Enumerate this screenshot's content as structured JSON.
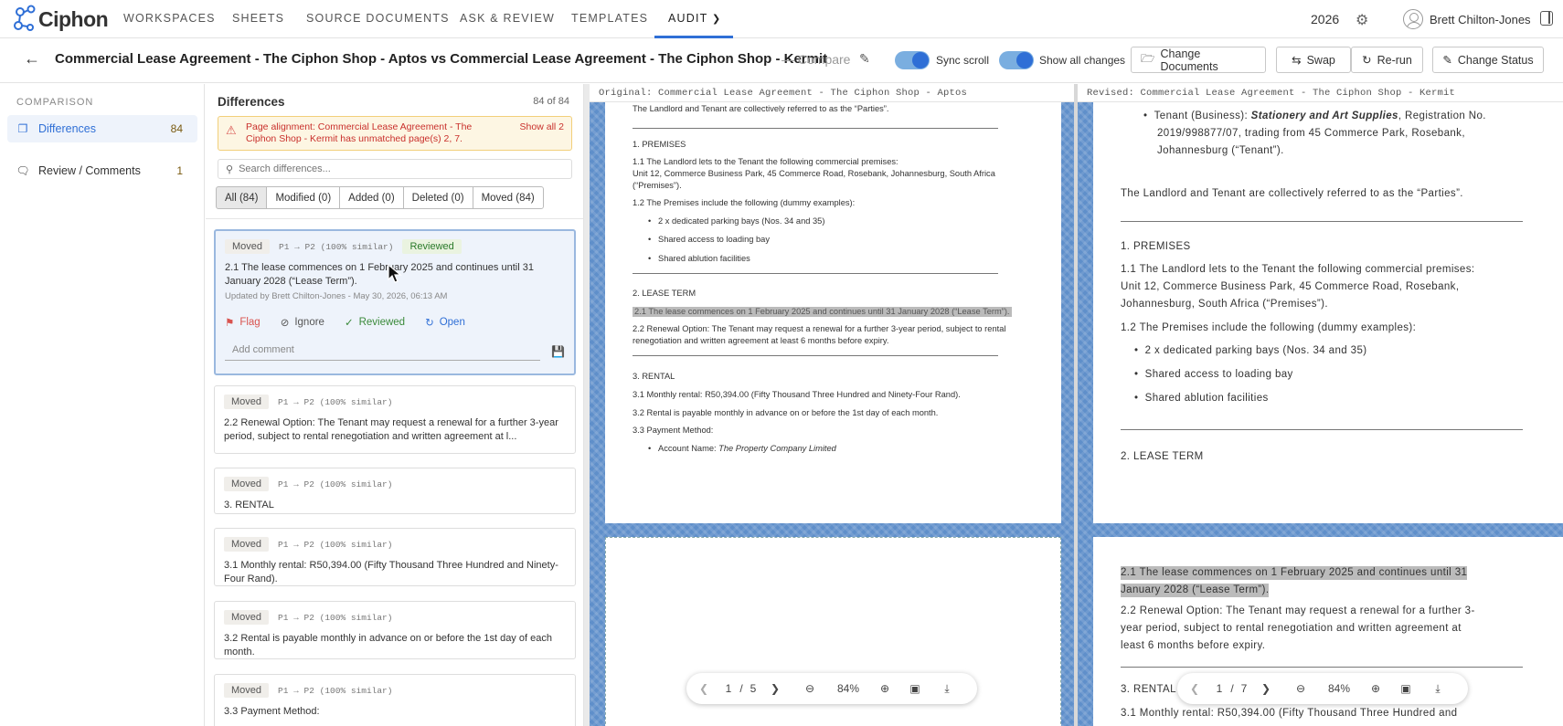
{
  "app": {
    "name": "Ciphon"
  },
  "nav": {
    "items": [
      "WORKSPACES",
      "SHEETS",
      "SOURCE DOCUMENTS",
      "ASK & REVIEW",
      "TEMPLATES",
      "AUDIT"
    ],
    "year": "2026",
    "user": "Brett Chilton-Jones"
  },
  "header": {
    "title": "Commercial Lease Agreement - The Ciphon Shop - Aptos vs Commercial Lease Agreement - The Ciphon Shop - Kermit",
    "compare": "— Compare",
    "sync_scroll": "Sync scroll",
    "show_all_changes": "Show all changes",
    "btn_change_documents": "Change Documents",
    "btn_swap": "Swap",
    "btn_rerun": "Re-run",
    "btn_change_status": "Change Status"
  },
  "sidebar": {
    "section": "COMPARISON",
    "items": [
      {
        "label": "Differences",
        "count": "84"
      },
      {
        "label": "Review / Comments",
        "count": "1"
      }
    ]
  },
  "differences": {
    "title": "Differences",
    "count": "84 of 84",
    "alert_text": "Page alignment: Commercial Lease Agreement - The Ciphon Shop - Kermit has unmatched page(s) 2, 7.",
    "alert_action": "Show all 2",
    "search_placeholder": "Search differences...",
    "filters": [
      "All (84)",
      "Modified (0)",
      "Added (0)",
      "Deleted (0)",
      "Moved (84)"
    ],
    "cards": [
      {
        "tag": "Moved",
        "meta": "P1 → P2 (100% similar)",
        "status": "Reviewed",
        "text": "2.1 The lease commences on 1 February 2025 and continues until 31 January 2028 (“Lease Term”).",
        "updated": "Updated by Brett Chilton-Jones - May 30, 2026, 06:13 AM"
      },
      {
        "tag": "Moved",
        "meta": "P1 → P2 (100% similar)",
        "text": "2.2 Renewal Option: The Tenant may request a renewal for a further 3-year period, subject to rental renegotiation and written agreement at l..."
      },
      {
        "tag": "Moved",
        "meta": "P1 → P2 (100% similar)",
        "text": "3. RENTAL"
      },
      {
        "tag": "Moved",
        "meta": "P1 → P2 (100% similar)",
        "text": "3.1 Monthly rental: R50,394.00 (Fifty Thousand Three Hundred and Ninety-Four Rand)."
      },
      {
        "tag": "Moved",
        "meta": "P1 → P2 (100% similar)",
        "text": "3.2 Rental is payable monthly in advance on or before the 1st day of each month."
      },
      {
        "tag": "Moved",
        "meta": "P1 → P2 (100% similar)",
        "text": "3.3 Payment Method:"
      }
    ],
    "actions": {
      "flag": "Flag",
      "ignore": "Ignore",
      "reviewed": "Reviewed",
      "open": "Open"
    },
    "comment_placeholder": "Add comment"
  },
  "original": {
    "header": "Original: Commercial Lease Agreement - The Ciphon Shop - Aptos",
    "lines": {
      "parties": "The Landlord and Tenant are collectively referred to as the “Parties”.",
      "premises": "1. PREMISES",
      "p11": "1.1 The Landlord lets to the Tenant the following commercial premises:",
      "p11b": "Unit 12, Commerce Business Park, 45 Commerce Road, Rosebank, Johannesburg, South Africa",
      "p11c": "(“Premises”).",
      "p12": "1.2 The Premises include the following (dummy examples):",
      "b1": "2 x dedicated parking bays (Nos. 34 and 35)",
      "b2": "Shared access to loading bay",
      "b3": "Shared ablution facilities",
      "lease": "2. LEASE TERM",
      "l21": "2.1 The lease commences on 1 February 2025 and continues until 31 January 2028 (“Lease Term”).",
      "l22": "2.2 Renewal Option: The Tenant may request a renewal for a further 3-year period, subject to rental",
      "l22b": "renegotiation and written agreement at least 6 months before expiry.",
      "rental": "3. RENTAL",
      "r31": "3.1 Monthly rental: R50,394.00 (Fifty Thousand Three Hundred and Ninety-Four Rand).",
      "r32": "3.2 Rental is payable monthly in advance on or before the 1st day of each month.",
      "r33": "3.3 Payment Method:",
      "acct_label": "Account Name: ",
      "acct_value": "The Property Company Limited"
    },
    "pager": {
      "page": "1",
      "sep": "/",
      "total": "5",
      "zoom": "84%"
    }
  },
  "revised": {
    "header": "Revised: Commercial Lease Agreement - The Ciphon Shop - Kermit",
    "lines": {
      "tenant_pre": "Tenant (Business): ",
      "tenant_name": "Stationery and Art Supplies",
      "tenant_post": ", Registration No.",
      "tenant2": "2019/998877/07, trading from 45 Commerce Park, Rosebank,",
      "tenant3": "Johannesburg (“Tenant”).",
      "parties": "The Landlord and Tenant are collectively referred to as the “Parties”.",
      "premises": "1. PREMISES",
      "p11": "1.1 The Landlord lets to the Tenant the following commercial premises:",
      "p11b": "Unit 12, Commerce Business Park, 45 Commerce Road, Rosebank,",
      "p11c": "Johannesburg, South Africa (“Premises”).",
      "p12": "1.2 The Premises include the following (dummy examples):",
      "b1": "2 x dedicated parking bays (Nos. 34 and 35)",
      "b2": "Shared access to loading bay",
      "b3": "Shared ablution facilities",
      "lease": "2. LEASE TERM",
      "l21": "2.1 The lease commences on 1 February 2025 and continues until 31",
      "l21b": "January 2028 (“Lease Term”).",
      "l22": "2.2 Renewal Option: The Tenant may request a renewal for a further 3-",
      "l22b": "year period, subject to rental renegotiation and written agreement at",
      "l22c": "least 6 months before expiry.",
      "rental": "3. RENTAL",
      "r31": "3.1 Monthly rental: R50,394.00 (Fifty Thousand Three Hundred and"
    },
    "pager": {
      "page": "1",
      "sep": "/",
      "total": "7",
      "zoom": "84%"
    }
  },
  "colors": {
    "accent": "#2f6fd6",
    "moved_tag_bg": "#f0eeea",
    "reviewed": "#2a7a2a",
    "flag": "#d9534f",
    "alert_bg": "#fdf6e3",
    "doc_bg": "#5f8fca"
  },
  "icons": [
    "back-arrow-icon",
    "pencil-icon",
    "gear-icon",
    "user-icon",
    "sidebar-toggle-icon",
    "folder-icon",
    "swap-icon",
    "refresh-icon",
    "edit-icon",
    "differences-icon",
    "comments-icon",
    "warning-icon",
    "search-icon",
    "flag-icon",
    "ignore-icon",
    "check-icon",
    "open-icon",
    "save-icon",
    "chevron-left-icon",
    "chevron-right-icon",
    "zoom-out-icon",
    "zoom-in-icon",
    "fit-icon",
    "download-icon"
  ]
}
